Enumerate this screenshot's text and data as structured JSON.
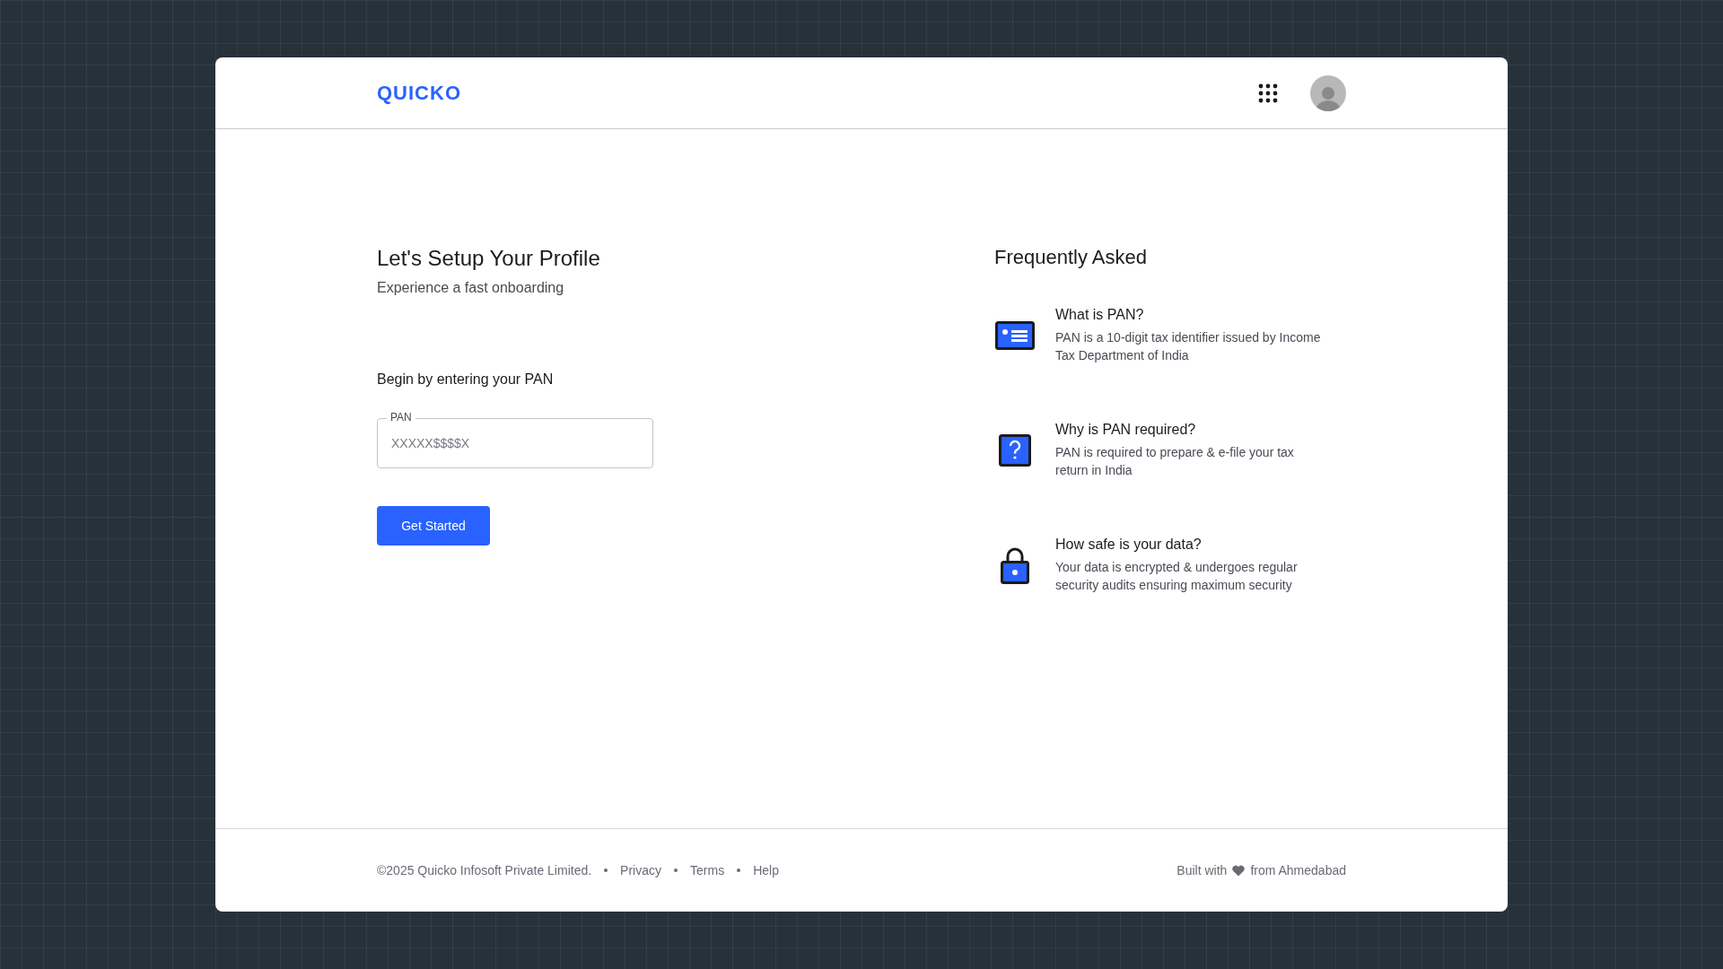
{
  "header": {
    "logo": "QUICKO"
  },
  "setup": {
    "title": "Let's Setup Your Profile",
    "subtitle": "Experience a fast onboarding",
    "prompt": "Begin by entering your PAN",
    "field": {
      "label": "PAN",
      "placeholder": "XXXXX$$$$X"
    },
    "button": "Get Started"
  },
  "faq": {
    "title": "Frequently Asked",
    "items": [
      {
        "kind": "card",
        "question": "What is PAN?",
        "answer": "PAN is a 10-digit tax identifier issued by Income Tax Department of India"
      },
      {
        "kind": "question",
        "question": "Why is PAN required?",
        "answer": "PAN is required to prepare & e-file your tax return in India"
      },
      {
        "kind": "lock",
        "question": "How safe is your data?",
        "answer": "Your data is encrypted & undergoes regular security audits ensuring maximum security"
      }
    ]
  },
  "footer": {
    "copyright": "©2025 Quicko Infosoft Private Limited.",
    "links": [
      "Privacy",
      "Terms",
      "Help"
    ],
    "built_before": "Built with",
    "built_after": "from Ahmedabad"
  }
}
